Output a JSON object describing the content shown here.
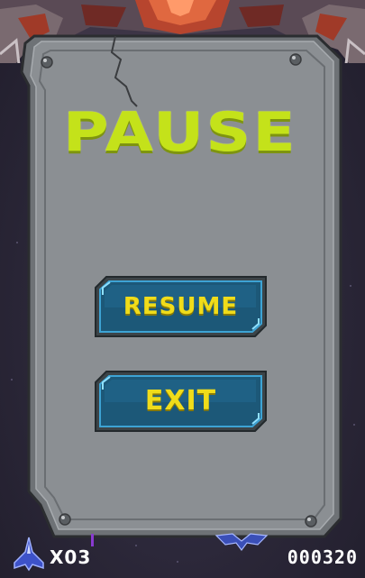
{
  "pause_menu": {
    "title": "PAUSE",
    "resume_label": "RESUME",
    "exit_label": "EXIT"
  },
  "hud": {
    "lives": "X03",
    "score": "000320"
  },
  "colors": {
    "title": "#c4e21a",
    "button_text": "#f0dc1a",
    "button_fill": "#1c5878",
    "panel": "#8a8e92"
  }
}
